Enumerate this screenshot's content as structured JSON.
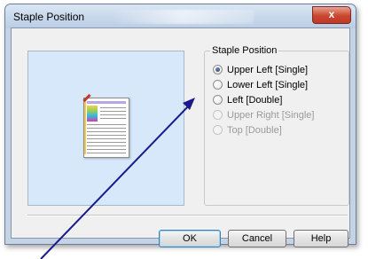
{
  "window": {
    "title": "Staple Position",
    "close_glyph": "x"
  },
  "group": {
    "label": "Staple Position"
  },
  "options": [
    {
      "label": "Upper Left [Single]",
      "checked": true,
      "enabled": true
    },
    {
      "label": "Lower Left [Single]",
      "checked": false,
      "enabled": true
    },
    {
      "label": "Left [Double]",
      "checked": false,
      "enabled": true
    },
    {
      "label": "Upper Right [Single]",
      "checked": false,
      "enabled": false
    },
    {
      "label": "Top [Double]",
      "checked": false,
      "enabled": false
    }
  ],
  "buttons": {
    "ok": "OK",
    "cancel": "Cancel",
    "help": "Help"
  },
  "colors": {
    "arrow": "#1a1a8c",
    "staple": "#c0392b",
    "preview_bg": "#d6e8fa"
  }
}
